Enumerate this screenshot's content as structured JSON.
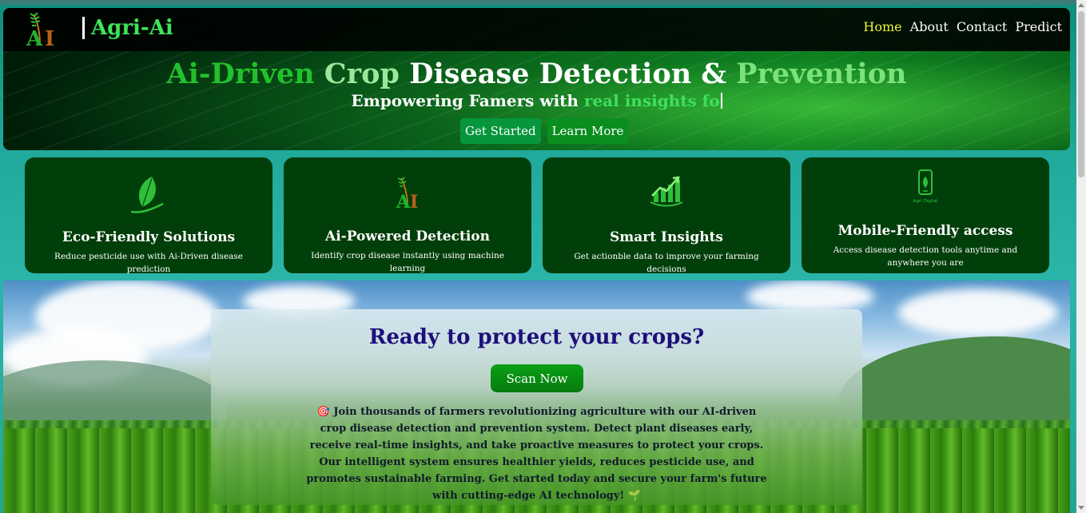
{
  "brand": {
    "name": "Agri-Ai",
    "logo_icon": "wheat-ai-logo-icon"
  },
  "nav": {
    "items": [
      "Home",
      "About",
      "Contact",
      "Predict"
    ],
    "active": "Home",
    "active_color": "#eef53a"
  },
  "hero": {
    "title_parts": [
      "Ai-Driven ",
      "Crop ",
      "Disease Detection & ",
      "Prevention"
    ],
    "subtitle_white": "Empowering Famers with ",
    "subtitle_green": "real insights fo",
    "buttons": {
      "get_started": "Get Started",
      "learn_more": "Learn More"
    }
  },
  "features": [
    {
      "icon": "leaf-icon",
      "title": "Eco-Friendly Solutions",
      "desc": "Reduce pesticide use with Ai-Driven disease prediction"
    },
    {
      "icon": "ai-logo-icon",
      "title": "Ai-Powered Detection",
      "desc": "Identify crop disease instantly using machine learning"
    },
    {
      "icon": "growth-chart-icon",
      "title": "Smart Insights",
      "desc": "Get actionble data to improve your farming decisions"
    },
    {
      "icon": "mobile-phone-icon",
      "title": "Mobile-Friendly access",
      "desc": "Access disease detection tools anytime and anywhere you are",
      "icon_caption": "Agri Digital"
    }
  ],
  "cta": {
    "title": "Ready to protect your crops?",
    "button": "Scan Now",
    "description": "🎯 Join thousands of farmers revolutionizing agriculture with our AI-driven crop disease detection and prevention system. Detect plant diseases early, receive real-time insights, and take proactive measures to protect your crops. Our intelligent system ensures healthier yields, reduces pesticide use, and promotes sustainable farming. Get started today and secure your farm's future with cutting-edge AI technology! 🌱"
  },
  "colors": {
    "brand_green": "#3ee55a",
    "card_bg": "#013f0a",
    "cta_title": "#1d0f7a"
  }
}
